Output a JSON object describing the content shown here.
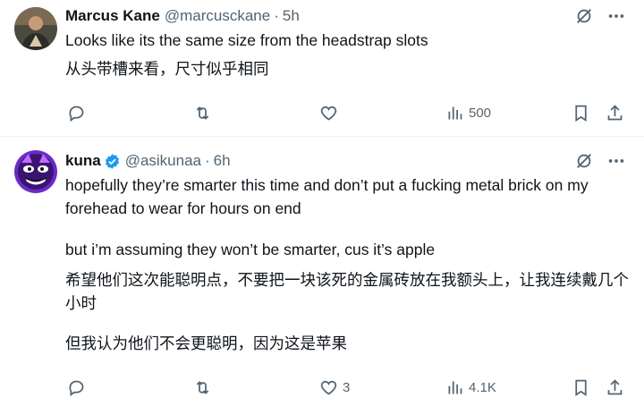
{
  "tweets": [
    {
      "name": "Marcus Kane",
      "handle": "@marcusckane",
      "sep": "·",
      "time": "5h",
      "text_en": "Looks like its the same size from the headstrap slots",
      "text_zh": "从头带槽来看，尺寸似乎相同",
      "replies": "",
      "retweets": "",
      "likes": "",
      "views": "500",
      "verified": false,
      "avatar": "man-in-dark-shirt"
    },
    {
      "name": "kuna",
      "handle": "@asikunaa",
      "sep": "·",
      "time": "6h",
      "p1": "hopefully they’re smarter this time and don’t put a fucking metal brick on my forehead to wear for hours on end",
      "p2": "but i’m assuming they won’t be smarter, cus it’s apple",
      "p3": "希望他们这次能聪明点，不要把一块该死的金属砖放在我额头上，让我连续戴几个小时",
      "p4": "但我认为他们不会更聪明，因为这是苹果",
      "replies": "",
      "retweets": "",
      "likes": "3",
      "views": "4.1K",
      "verified": true,
      "avatar": "purple-cartoon-face"
    }
  ],
  "colors": {
    "text": "#0f1419",
    "muted": "#536471",
    "verified": "#1d9bf0",
    "divider": "#eff3f4"
  }
}
